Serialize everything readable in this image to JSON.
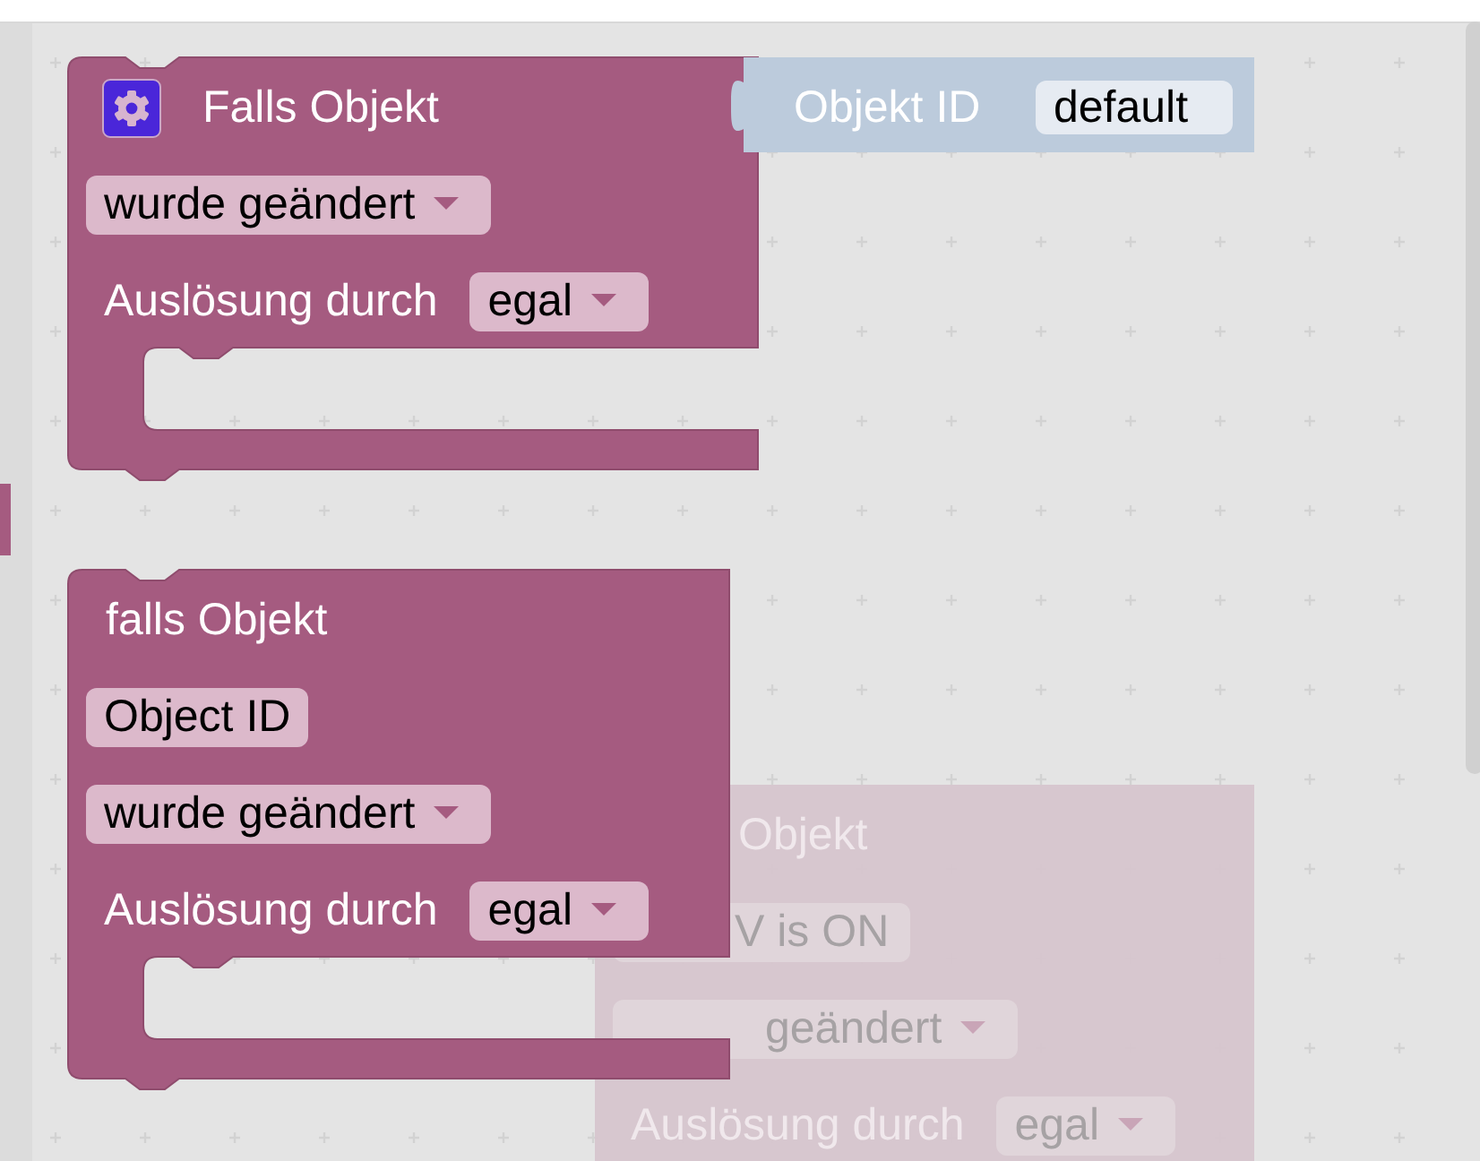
{
  "blocks": [
    {
      "kind": "trigger",
      "icon": true,
      "disabled": false,
      "title": "Falls Objekt",
      "input": {
        "label": "Objekt ID",
        "value": "default"
      },
      "fields": [
        {
          "kind": "dropdown",
          "text": "wurde geändert"
        },
        {
          "kind": "labeled-dropdown",
          "label": "Auslösung durch",
          "text": "egal"
        }
      ]
    },
    {
      "kind": "trigger",
      "icon": false,
      "disabled": false,
      "title": "falls Objekt",
      "fields": [
        {
          "kind": "value",
          "text": "Object ID"
        },
        {
          "kind": "dropdown",
          "text": "wurde geändert"
        },
        {
          "kind": "labeled-dropdown",
          "label": "Auslösung durch",
          "text": "egal"
        }
      ]
    },
    {
      "kind": "trigger",
      "icon": false,
      "disabled": true,
      "title": "Objekt",
      "fields": [
        {
          "kind": "value",
          "text": "V is ON"
        },
        {
          "kind": "dropdown",
          "text": "geändert"
        },
        {
          "kind": "labeled-dropdown",
          "label": "Auslösung durch",
          "text": "egal"
        }
      ]
    }
  ]
}
